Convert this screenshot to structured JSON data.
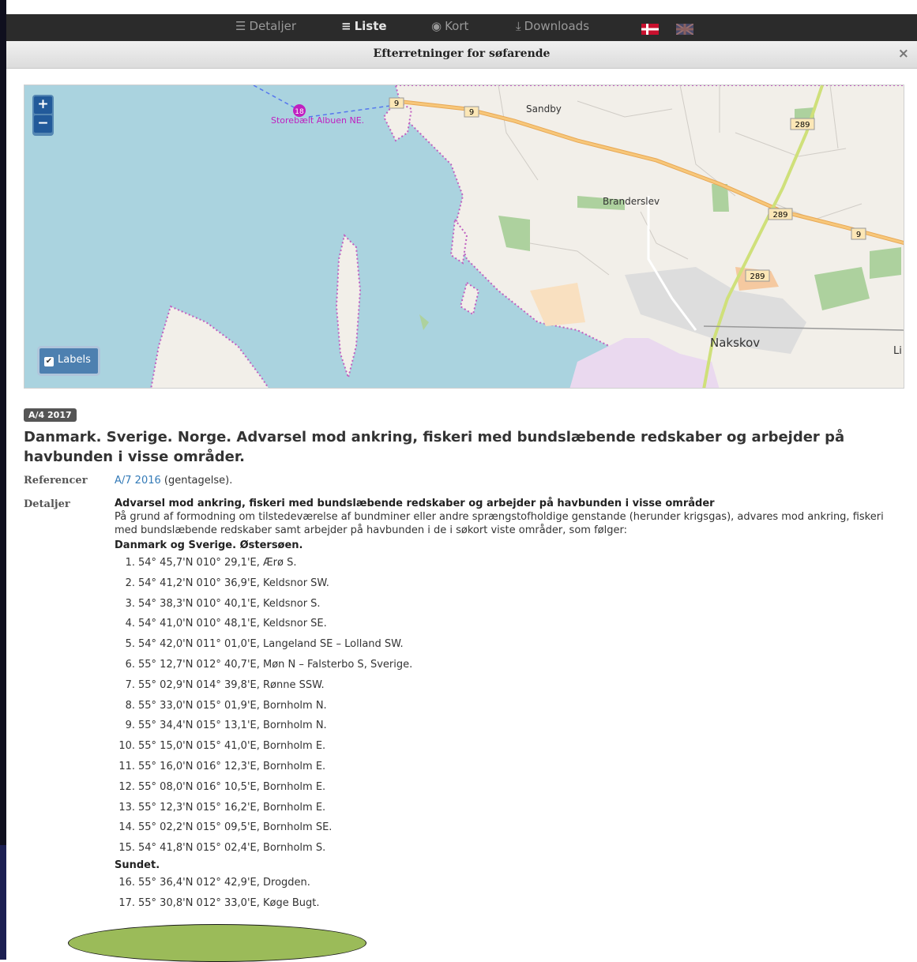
{
  "nav": {
    "items": [
      {
        "icon": "list-detail-icon",
        "label": "Detaljer"
      },
      {
        "icon": "list-icon",
        "label": "Liste"
      },
      {
        "icon": "globe-icon",
        "label": "Kort"
      },
      {
        "icon": "download-icon",
        "label": "Downloads"
      }
    ],
    "active": "Liste",
    "flags": [
      "danish-flag-icon",
      "uk-flag-icon"
    ]
  },
  "modal": {
    "title": "Efterretninger for søfarende",
    "close": "×"
  },
  "map": {
    "zoom_in": "+",
    "zoom_out": "−",
    "labels_toggle": "Labels",
    "marker_number": "18",
    "place_labels": [
      "Sandby",
      "Branderslev",
      "Nakskov",
      "Storebælt Albuen NE.",
      "Li"
    ],
    "road_labels": [
      "9",
      "9",
      "289",
      "289",
      "9",
      "289"
    ],
    "colors": {
      "sea": "#aad3df",
      "land": "#f2efe9",
      "road": "#f7c77a",
      "marker": "#c020c0"
    }
  },
  "notice": {
    "badge": "A/4 2017",
    "title": "Danmark. Sverige. Norge. Advarsel mod ankring, fiskeri med bundslæbende redskaber og arbejder på havbunden i visse områder.",
    "references_label": "Referencer",
    "reference_link": "A/7 2016",
    "reference_suffix": " (gentagelse).",
    "details_label": "Detaljer",
    "details_heading": "Advarsel mod ankring, fiskeri med bundslæbende redskaber og arbejder på havbunden i visse områder",
    "details_text": "På grund af formodning om tilstedeværelse af bundminer eller andre sprængstofholdige genstande (herunder krigsgas), advares mod ankring, fiskeri med bundslæbende redskaber samt arbejder på havbunden i de i søkort viste områder, som følger:",
    "area1": "Danmark og Sverige. Østersøen.",
    "positions1": [
      {
        "n": "1.",
        "text": "54° 45,7'N 010° 29,1'E, Ærø S."
      },
      {
        "n": "2.",
        "text": "54° 41,2'N 010° 36,9'E, Keldsnor SW."
      },
      {
        "n": "3.",
        "text": "54° 38,3'N 010° 40,1'E, Keldsnor S."
      },
      {
        "n": "4.",
        "text": "54° 41,0'N 010° 48,1'E, Keldsnor SE."
      },
      {
        "n": "5.",
        "text": "54° 42,0'N 011° 01,0'E, Langeland SE – Lolland SW."
      },
      {
        "n": "6.",
        "text": "55° 12,7'N 012° 40,7'E, Møn N – Falsterbo S, Sverige."
      },
      {
        "n": "7.",
        "text": "55° 02,9'N 014° 39,8'E, Rønne SSW."
      },
      {
        "n": "8.",
        "text": "55° 33,0'N 015° 01,9'E, Bornholm N."
      },
      {
        "n": "9.",
        "text": "55° 34,4'N 015° 13,1'E, Bornholm N."
      },
      {
        "n": "10.",
        "text": "55° 15,0'N 015° 41,0'E, Bornholm E."
      },
      {
        "n": "11.",
        "text": "55° 16,0'N 016° 12,3'E, Bornholm E."
      },
      {
        "n": "12.",
        "text": "55° 08,0'N 016° 10,5'E, Bornholm E."
      },
      {
        "n": "13.",
        "text": "55° 12,3'N 015° 16,2'E, Bornholm E."
      },
      {
        "n": "14.",
        "text": "55° 02,2'N 015° 09,5'E, Bornholm SE."
      },
      {
        "n": "15.",
        "text": "54° 41,8'N 015° 02,4'E, Bornholm S."
      }
    ],
    "area2": "Sundet.",
    "positions2": [
      {
        "n": "16.",
        "text": "55° 36,4'N 012° 42,9'E, Drogden."
      },
      {
        "n": "17.",
        "text": "55° 30,8'N 012° 33,0'E, Køge Bugt."
      }
    ]
  },
  "overlay_color": "#9bbb59"
}
